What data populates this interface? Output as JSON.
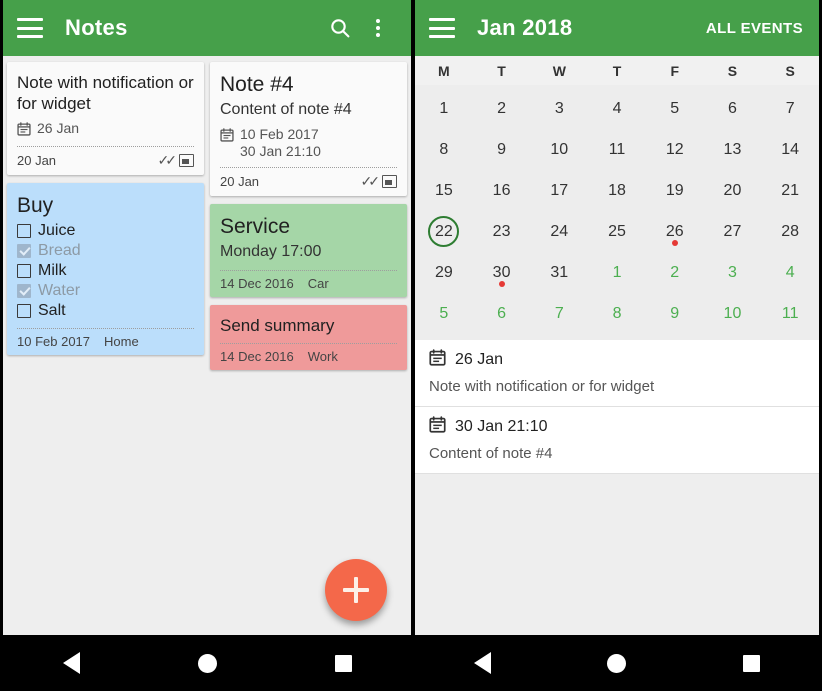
{
  "notes_screen": {
    "appbar": {
      "menu_icon": "hamburger-menu-icon",
      "title": "Notes",
      "search_icon": "search-icon",
      "overflow_icon": "overflow-menu-icon"
    },
    "fab": {
      "icon": "plus-icon",
      "color": "#f4684a"
    },
    "columns": [
      {
        "notes": [
          {
            "id": "note-with-notification",
            "title": "Note with notification or for widget",
            "title_size": "normal",
            "color": "#fafafa",
            "reminder_icon": "calendar-icon",
            "reminder_lines": [
              "26 Jan"
            ],
            "footer_date": "20 Jan",
            "footer_tag": "",
            "has_done_icon": true,
            "has_widget_icon": true,
            "checklist": []
          },
          {
            "id": "note-buy",
            "title": "Buy",
            "title_size": "big",
            "color": "#bbdefb",
            "reminder_icon": "",
            "reminder_lines": [],
            "footer_date": "10 Feb 2017",
            "footer_tag": "Home",
            "has_done_icon": false,
            "has_widget_icon": false,
            "checklist": [
              {
                "label": "Juice",
                "checked": false
              },
              {
                "label": "Bread",
                "checked": true
              },
              {
                "label": "Milk",
                "checked": false
              },
              {
                "label": "Water",
                "checked": true
              },
              {
                "label": "Salt",
                "checked": false
              }
            ]
          }
        ]
      },
      {
        "notes": [
          {
            "id": "note-4",
            "title": "Note #4",
            "title_size": "big",
            "body": "Content of note #4",
            "color": "#fafafa",
            "reminder_icon": "calendar-icon",
            "reminder_lines": [
              "10 Feb 2017",
              "30 Jan 21:10"
            ],
            "footer_date": "20 Jan",
            "footer_tag": "",
            "has_done_icon": true,
            "has_widget_icon": true,
            "checklist": []
          },
          {
            "id": "note-service",
            "title": "Service",
            "title_size": "big",
            "body": "Monday 17:00",
            "color": "#a5d6a7",
            "reminder_icon": "",
            "reminder_lines": [],
            "footer_date": "14 Dec 2016",
            "footer_tag": "Car",
            "has_done_icon": false,
            "has_widget_icon": false,
            "checklist": []
          },
          {
            "id": "note-send-summary",
            "title": "Send summary",
            "title_size": "normal",
            "color": "#ef9a9a",
            "reminder_icon": "",
            "reminder_lines": [],
            "footer_date": "14 Dec 2016",
            "footer_tag": "Work",
            "has_done_icon": false,
            "has_widget_icon": false,
            "checklist": []
          }
        ]
      }
    ]
  },
  "calendar_screen": {
    "appbar": {
      "menu_icon": "hamburger-menu-icon",
      "title": "Jan 2018",
      "action_label": "ALL EVENTS"
    },
    "weekdays": [
      "M",
      "T",
      "W",
      "T",
      "F",
      "S",
      "S"
    ],
    "weeks": [
      [
        {
          "day": "1"
        },
        {
          "day": "2"
        },
        {
          "day": "3"
        },
        {
          "day": "4"
        },
        {
          "day": "5"
        },
        {
          "day": "6"
        },
        {
          "day": "7"
        }
      ],
      [
        {
          "day": "8"
        },
        {
          "day": "9"
        },
        {
          "day": "10"
        },
        {
          "day": "11"
        },
        {
          "day": "12"
        },
        {
          "day": "13"
        },
        {
          "day": "14"
        }
      ],
      [
        {
          "day": "15"
        },
        {
          "day": "16"
        },
        {
          "day": "17"
        },
        {
          "day": "18"
        },
        {
          "day": "19"
        },
        {
          "day": "20"
        },
        {
          "day": "21"
        }
      ],
      [
        {
          "day": "22",
          "today": true
        },
        {
          "day": "23"
        },
        {
          "day": "24"
        },
        {
          "day": "25"
        },
        {
          "day": "26",
          "event": true
        },
        {
          "day": "27"
        },
        {
          "day": "28"
        }
      ],
      [
        {
          "day": "29"
        },
        {
          "day": "30",
          "event": true
        },
        {
          "day": "31"
        },
        {
          "day": "1",
          "other": true
        },
        {
          "day": "2",
          "other": true
        },
        {
          "day": "3",
          "other": true
        },
        {
          "day": "4",
          "other": true
        }
      ],
      [
        {
          "day": "5",
          "other": true
        },
        {
          "day": "6",
          "other": true
        },
        {
          "day": "7",
          "other": true
        },
        {
          "day": "8",
          "other": true
        },
        {
          "day": "9",
          "other": true
        },
        {
          "day": "10",
          "other": true
        },
        {
          "day": "11",
          "other": true
        }
      ]
    ],
    "events": [
      {
        "icon": "calendar-icon",
        "date": "26 Jan",
        "text": "Note with notification or for widget"
      },
      {
        "icon": "calendar-icon",
        "date": "30 Jan 21:10",
        "text": "Content of note #4"
      }
    ]
  },
  "navbar": {
    "back_icon": "back-triangle-icon",
    "home_icon": "home-circle-icon",
    "recents_icon": "recents-square-icon"
  }
}
